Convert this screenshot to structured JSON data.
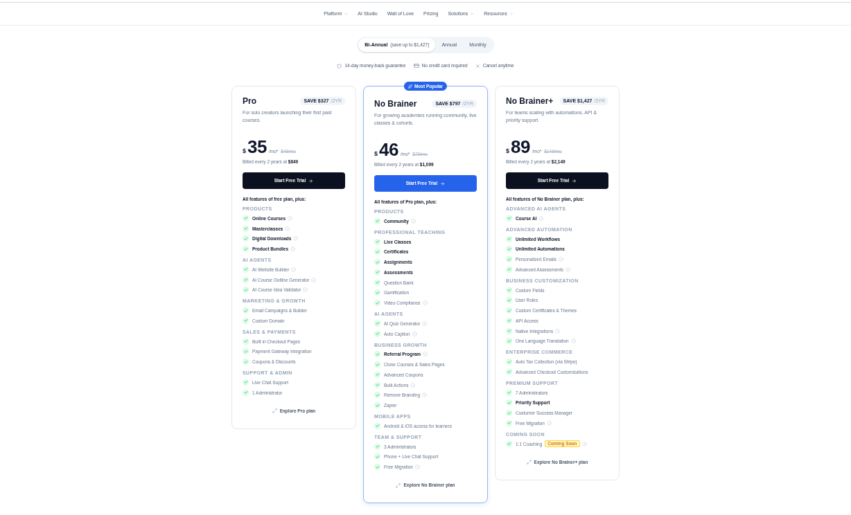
{
  "nav": {
    "items": [
      {
        "label": "Platform",
        "dropdown": true
      },
      {
        "label": "AI Studio",
        "dropdown": false
      },
      {
        "label": "Wall of Love",
        "dropdown": false
      },
      {
        "label": "Pricing",
        "dropdown": false
      },
      {
        "label": "Solutions",
        "dropdown": true
      },
      {
        "label": "Resources",
        "dropdown": true
      }
    ]
  },
  "billing_toggle": {
    "options": [
      {
        "label": "Bi-Annual",
        "note": "(save up to $1,427)",
        "selected": true
      },
      {
        "label": "Annual",
        "selected": false
      },
      {
        "label": "Monthly",
        "selected": false
      }
    ]
  },
  "guarantees": [
    {
      "kind": "refund",
      "label": "14-day money-back guarantee"
    },
    {
      "kind": "payment",
      "label": "No credit card required"
    },
    {
      "kind": "cancel",
      "label": "Cancel anytime"
    }
  ],
  "plans": [
    {
      "name": "Pro",
      "featured": false,
      "save": "SAVE $327",
      "save_period": "/2YR",
      "description": "For solo creators launching their first paid courses.",
      "currency": "$",
      "price": "35",
      "unit": "/mo*",
      "old_price": "$49/mo",
      "billed": "Billed every 2 years at **$849**",
      "button": "Start Free Trial",
      "features_heading": "All features of free plan, plus:",
      "groups": [
        {
          "title": "PRODUCTS",
          "features": [
            {
              "label": "Online Courses",
              "highlighted": true,
              "info": true
            },
            {
              "label": "Masterclasses",
              "highlighted": true,
              "info": true
            },
            {
              "label": "Digital Downloads",
              "highlighted": true,
              "info": true
            },
            {
              "label": "Product Bundles",
              "highlighted": true,
              "info": true
            }
          ]
        },
        {
          "title": "AI AGENTS",
          "features": [
            {
              "label": "AI Website Builder",
              "highlighted": false,
              "info": true
            },
            {
              "label": "AI Course Outline Generator",
              "highlighted": false,
              "info": true
            },
            {
              "label": "AI Course Idea Validator",
              "highlighted": false,
              "info": true
            }
          ]
        },
        {
          "title": "MARKETING & GROWTH",
          "features": [
            {
              "label": "Email Campaigns & Builder",
              "highlighted": false,
              "info": false
            },
            {
              "label": "Custom Domain",
              "highlighted": false,
              "info": false
            }
          ]
        },
        {
          "title": "SALES & PAYMENTS",
          "features": [
            {
              "label": "Built in Checkout Pages",
              "highlighted": false,
              "info": false
            },
            {
              "label": "Payment Gateway Integration",
              "highlighted": false,
              "info": false
            },
            {
              "label": "Coupons & Discounts",
              "highlighted": false,
              "info": false
            }
          ]
        },
        {
          "title": "SUPPORT & ADMIN",
          "features": [
            {
              "label": "Live Chat Support",
              "highlighted": false,
              "info": false
            },
            {
              "label": "1 Administrator",
              "highlighted": false,
              "info": false
            }
          ]
        }
      ],
      "explore": "Explore Pro plan"
    },
    {
      "name": "No Brainer",
      "featured": true,
      "badge": "Most Popular",
      "save": "SAVE $797",
      "save_period": "/2YR",
      "description": "For growing academies running community, live classes & cohorts.",
      "currency": "$",
      "price": "46",
      "unit": "/mo*",
      "old_price": "$79/mo",
      "billed": "Billed every 2 years at **$1,099**",
      "button": "Start Free Trial",
      "features_heading": "All features of Pro plan, plus:",
      "groups": [
        {
          "title": "PRODUCTS",
          "features": [
            {
              "label": "Community",
              "highlighted": true,
              "info": true
            }
          ]
        },
        {
          "title": "PROFESSIONAL TEACHING",
          "features": [
            {
              "label": "Live Classes",
              "highlighted": true,
              "info": false
            },
            {
              "label": "Certificates",
              "highlighted": true,
              "info": false
            },
            {
              "label": "Assignments",
              "highlighted": true,
              "info": false
            },
            {
              "label": "Assessments",
              "highlighted": true,
              "info": false
            },
            {
              "label": "Question Bank",
              "highlighted": false,
              "info": false
            },
            {
              "label": "Gamification",
              "highlighted": false,
              "info": false
            },
            {
              "label": "Video Compliance",
              "highlighted": false,
              "info": true
            }
          ]
        },
        {
          "title": "AI AGENTS",
          "features": [
            {
              "label": "AI Quiz Generator",
              "highlighted": false,
              "info": true
            },
            {
              "label": "Auto Caption",
              "highlighted": false,
              "info": true
            }
          ]
        },
        {
          "title": "BUSINESS GROWTH",
          "features": [
            {
              "label": "Referral Program",
              "highlighted": true,
              "info": true
            },
            {
              "label": "Clone Courses & Sales Pages",
              "highlighted": false,
              "info": false
            },
            {
              "label": "Advanced Coupons",
              "highlighted": false,
              "info": false
            },
            {
              "label": "Bulk Actions",
              "highlighted": false,
              "info": true
            },
            {
              "label": "Remove Branding",
              "highlighted": false,
              "info": true
            },
            {
              "label": "Zapier",
              "highlighted": false,
              "info": false
            }
          ]
        },
        {
          "title": "MOBILE APPS",
          "features": [
            {
              "label": "Android & iOS access for learners",
              "highlighted": false,
              "info": false
            }
          ]
        },
        {
          "title": "TEAM & SUPPORT",
          "features": [
            {
              "label": "3 Administrators",
              "highlighted": false,
              "info": false
            },
            {
              "label": "Phone + Live Chat Support",
              "highlighted": false,
              "info": false
            },
            {
              "label": "Free Migration",
              "highlighted": false,
              "info": true
            }
          ]
        }
      ],
      "explore": "Explore No Brainer plan"
    },
    {
      "name": "No Brainer+",
      "featured": false,
      "save": "SAVE $1,427",
      "save_period": "/2YR",
      "description": "For teams scaling with automations, API & priority support.",
      "currency": "$",
      "price": "89",
      "unit": "/mo*",
      "old_price": "$149/mo",
      "billed": "Billed every 2 years at **$2,149**",
      "button": "Start Free Trial",
      "features_heading": "All features of No Brainer plan, plus:",
      "groups": [
        {
          "title": "ADVANCED AI AGENTS",
          "features": [
            {
              "label": "Course AI",
              "highlighted": true,
              "info": true
            }
          ]
        },
        {
          "title": "ADVANCED AUTOMATION",
          "features": [
            {
              "label": "Unlimited Workflows",
              "highlighted": true,
              "info": false
            },
            {
              "label": "Unlimited Automations",
              "highlighted": true,
              "info": false
            },
            {
              "label": "Personalized Emails",
              "highlighted": false,
              "info": true
            },
            {
              "label": "Advanced Assessments",
              "highlighted": false,
              "info": true
            }
          ]
        },
        {
          "title": "BUSINESS CUSTOMIZATION",
          "features": [
            {
              "label": "Custom Fields",
              "highlighted": false,
              "info": false
            },
            {
              "label": "User Roles",
              "highlighted": false,
              "info": false
            },
            {
              "label": "Custom Certificates & Themes",
              "highlighted": false,
              "info": false
            },
            {
              "label": "API Access",
              "highlighted": false,
              "info": false
            },
            {
              "label": "Native Integrations",
              "highlighted": false,
              "info": true
            },
            {
              "label": "One Language Translation",
              "highlighted": false,
              "info": true
            }
          ]
        },
        {
          "title": "ENTERPRISE COMMERCE",
          "features": [
            {
              "label": "Auto Tax Collection (via Stripe)",
              "highlighted": false,
              "info": false
            },
            {
              "label": "Advanced Checkout Customizations",
              "highlighted": false,
              "info": false
            }
          ]
        },
        {
          "title": "PREMIUM SUPPORT",
          "features": [
            {
              "label": "7 Administrators",
              "highlighted": false,
              "info": false
            },
            {
              "label": "Priority Support",
              "highlighted": true,
              "info": false
            },
            {
              "label": "Customer Success Manager",
              "highlighted": false,
              "info": false
            },
            {
              "label": "Free Migration",
              "highlighted": false,
              "info": true
            }
          ]
        },
        {
          "title": "COMING SOON",
          "features": [
            {
              "label": "1:1 Coaching",
              "highlighted": false,
              "info": true,
              "tag": "Coming Soon"
            }
          ]
        }
      ],
      "explore": "Explore No Brainer+ plan"
    }
  ]
}
